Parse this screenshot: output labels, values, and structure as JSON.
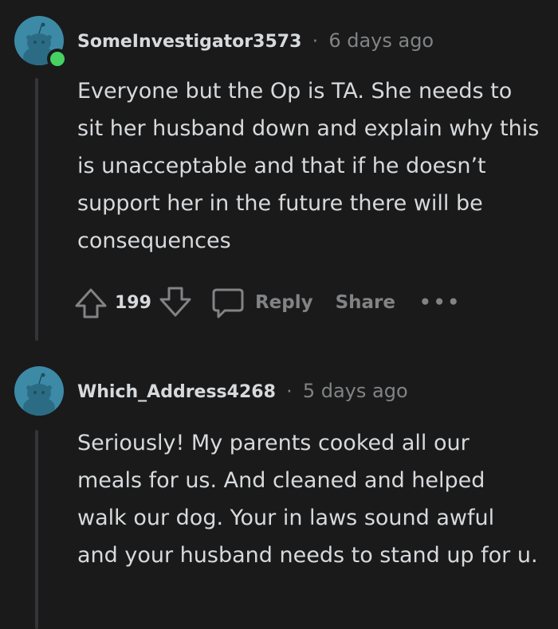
{
  "comments": [
    {
      "username": "SomeInvestigator3573",
      "separator": "·",
      "timestamp": "6 days ago",
      "online": true,
      "body": "Everyone but the Op is TA. She needs to sit her husband down and explain why this is unacceptable and that if he doesn’t support her in the future there will be consequences",
      "votes": "199",
      "reply_label": "Reply",
      "share_label": "Share",
      "more_label": "•••"
    },
    {
      "username": "Which_Address4268",
      "separator": "·",
      "timestamp": "5 days ago",
      "online": false,
      "body": "Seriously! My parents cooked all our meals for us. And cleaned and helped walk our dog. Your in laws sound awful and your husband needs to stand up for u."
    }
  ],
  "icons": {
    "upvote": "upvote-arrow-icon",
    "downvote": "downvote-arrow-icon",
    "reply": "speech-bubble-icon",
    "avatar": "snoo-avatar-icon"
  },
  "colors": {
    "background": "#1a1a1b",
    "text": "#d7dadc",
    "muted": "#818384",
    "avatar": "#3d8aa7",
    "online": "#46d160"
  }
}
